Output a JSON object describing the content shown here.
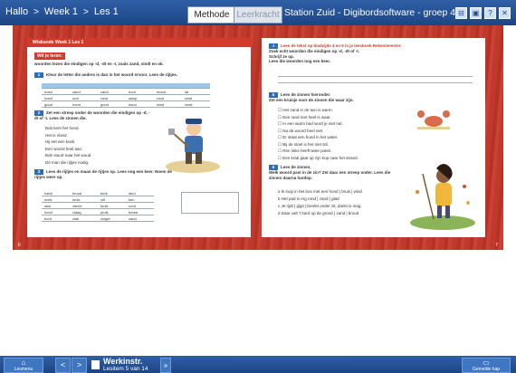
{
  "topbar": {
    "crumbs": [
      "Hallo",
      "Week 1",
      "Les 1"
    ],
    "separator": ">",
    "tabs": [
      {
        "label": "Methode",
        "active": true
      },
      {
        "label": "Leerkracht",
        "active": false
      }
    ],
    "app_title": "Station Zuid - Digibordsoftware - groep 4",
    "window_buttons": [
      "⊟",
      "▣",
      "?",
      "✕"
    ]
  },
  "book": {
    "left": {
      "band": "Wiskunde Week 1 Les 1",
      "header": "Wil je leren:",
      "intro": "woorden lezen die eindigen op -d, -dt en -t, zoals zand, vindt en ok.",
      "exercises": [
        {
          "num": "1",
          "text": "Kleur de letter die anders is dan in het woord ervoor. Lees de rijtjes."
        },
        {
          "num": "2",
          "text": "Zet een streep onder de woorden die eindigen op -d, -dt of -t. Lees de zinnen die."
        },
        {
          "num": "3",
          "text": "Lees de rijtjes en maan de rijtjes op. Lees nog een keer. Noem de rijtjes weer op."
        }
      ],
      "table1": [
        [
          "hoed",
          "zand",
          "zand",
          "hout",
          "mond",
          "lat"
        ],
        [
          "hoed",
          "oud",
          "rond",
          "wesp",
          "rond",
          "wind"
        ],
        [
          "goud",
          "hond",
          "goud",
          "koud",
          "wind",
          "vindt"
        ]
      ],
      "sentences": [
        "Bob kent het hond.",
        "Het is vloed.",
        "Hij eet een koek.",
        "Een woord heel aan.",
        "Bob stuurt naar het woud.",
        "De man die rijtjes nodig."
      ],
      "table2": [
        [
          "hand",
          "brood",
          "berk",
          "land"
        ],
        [
          "melk",
          "kruis",
          "vilt",
          "tuin"
        ],
        [
          "stuk",
          "vlecht",
          "kruik",
          "rond"
        ],
        [
          "hond",
          "vlaag",
          "pruik",
          "breed"
        ],
        [
          "bord",
          "vlak",
          "zuigel",
          "zand"
        ]
      ],
      "page_num": "6"
    },
    "right": {
      "ex4": {
        "num": "4",
        "title": "Lees de tekst op bladzijde 4 en 5 in je leesboek Rekenmeester.",
        "lines": [
          "Zoek echt woorden die eindigen op -d, -dt of -t.",
          "Schrijf ze op.",
          "Lees die woorden nog een keer."
        ]
      },
      "ex5": {
        "num": "5",
        "title": "Lees de zinnen hieronder.",
        "sub": "Zet een kruisje voor de zinnen die waar zijn.",
        "items": [
          "Het zand in de tuin is warm.",
          "Een rand met heel is waar.",
          "In een warm bad word je niet nat.",
          "Na de woord heel niet.",
          "Er staat een hond in het water.",
          "Bij de stoel is het niet stil.",
          "Ren links heeft twee poten.",
          "Een krab gaat op zijn kop naar het strand."
        ]
      },
      "ex6": {
        "num": "6",
        "title": "Lees de zinnen.",
        "sub": "Welk woord past in de zin? Zet daar een streep onder. Lees die zinnen daarna hardop.",
        "items": [
          "Ik loop in het bos met een hond | bruis | wind",
          "Het pad is erg rond | zand | glad",
          "Je rijdt | gijpt | breekt onder zit, dankt is mag.",
          "Daar valt 't hard op de grond | zand | brood"
        ]
      },
      "page_num": "7"
    }
  },
  "bottombar": {
    "menu_label": "Lesmenu",
    "prev": "<",
    "next": ">",
    "title": "Werkinstr.",
    "subtitle": "Lesitem 5 van 14",
    "expand": "»",
    "help_label": "Gemelde hap"
  }
}
